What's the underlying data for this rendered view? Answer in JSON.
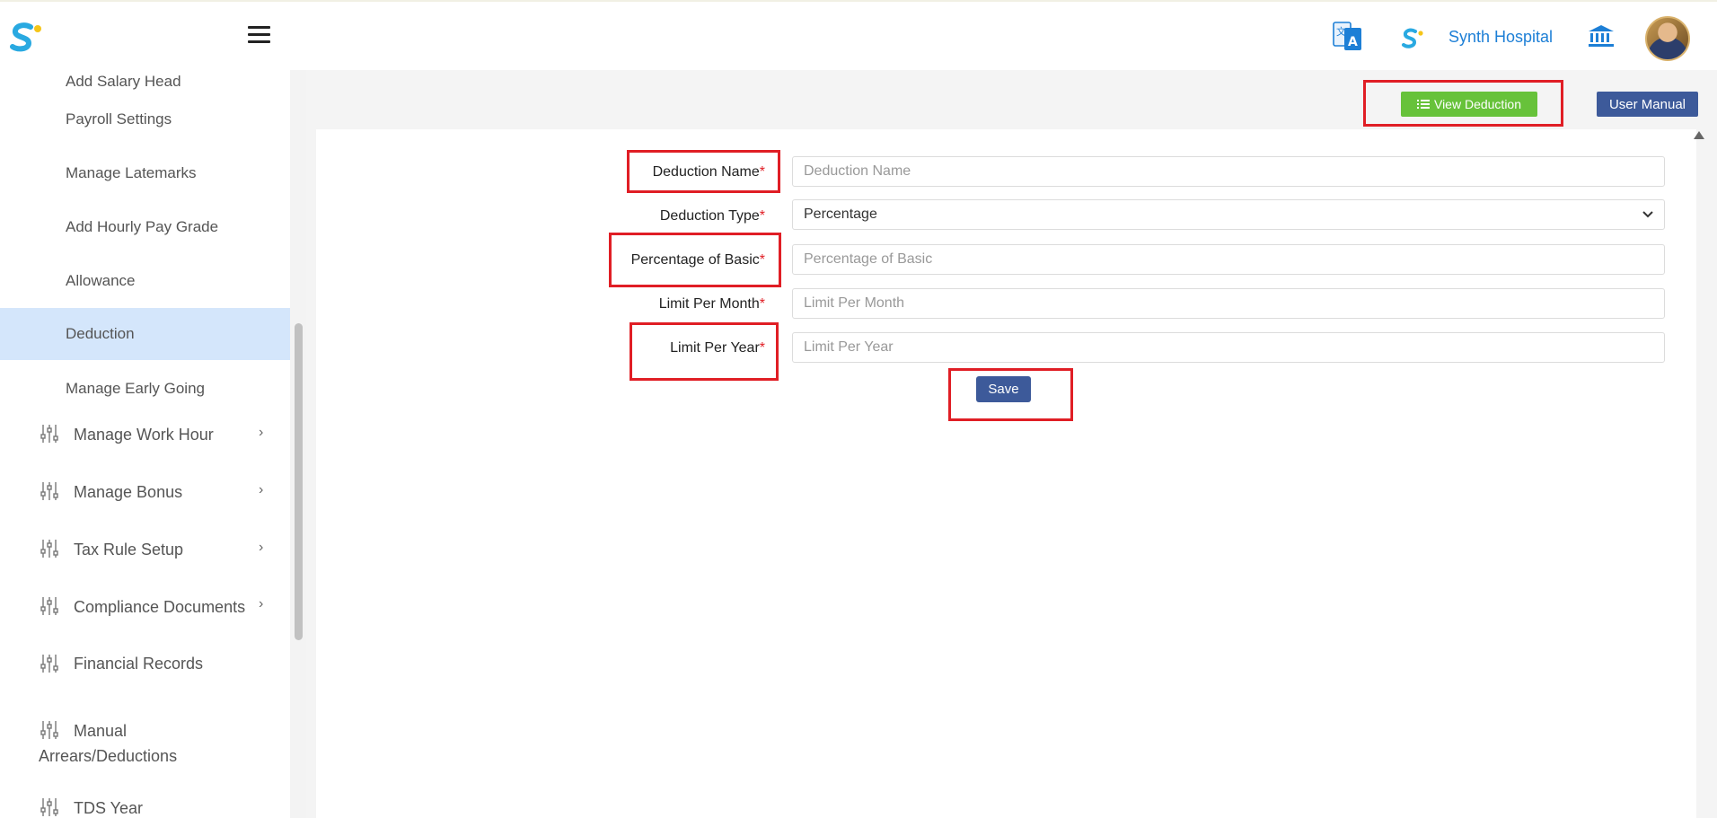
{
  "header": {
    "logo_icon": "synth-logo-icon",
    "menu_icon": "hamburger-icon",
    "translate_icon": "translate-icon",
    "hospital_logo_icon": "synth-logo-icon",
    "hospital_name": "Synth Hospital",
    "bank_icon": "bank-icon",
    "avatar": "user-avatar"
  },
  "sidebar": {
    "partial_top": "Add Salary Head",
    "items": [
      {
        "label": "Payroll Settings"
      },
      {
        "label": "Manage Latemarks"
      },
      {
        "label": "Add Hourly Pay Grade"
      },
      {
        "label": "Allowance"
      },
      {
        "label": "Deduction",
        "active": true
      },
      {
        "label": "Manage Early Going"
      }
    ],
    "groups": [
      {
        "label": "Manage Work Hour",
        "icon": "sliders-icon",
        "has_children": true
      },
      {
        "label": "Manage Bonus",
        "icon": "sliders-icon",
        "has_children": true
      },
      {
        "label": "Tax Rule Setup",
        "icon": "sliders-icon",
        "has_children": true
      },
      {
        "label": "Compliance Documents",
        "icon": "sliders-icon",
        "has_children": true
      },
      {
        "label": "Financial Records",
        "icon": "sliders-icon",
        "has_children": false
      },
      {
        "label_line1": "Manual",
        "label_line2": "Arrears/Deductions",
        "icon": "sliders-icon",
        "has_children": false
      },
      {
        "label": "TDS Year",
        "icon": "sliders-icon",
        "has_children": false
      }
    ]
  },
  "toolbar": {
    "view_deduction_label": "View Deduction",
    "view_deduction_icon": "list-icon",
    "user_manual_label": "User Manual"
  },
  "form": {
    "deduction_name": {
      "label": "Deduction Name",
      "required": "*",
      "placeholder": "Deduction Name",
      "value": ""
    },
    "deduction_type": {
      "label": "Deduction Type",
      "required": "*",
      "value": "Percentage"
    },
    "percentage_of_basic": {
      "label": "Percentage of Basic",
      "required": "*",
      "placeholder": "Percentage of Basic",
      "value": ""
    },
    "limit_per_month": {
      "label": "Limit Per Month",
      "required": "*",
      "placeholder": "Limit Per Month",
      "value": ""
    },
    "limit_per_year": {
      "label": "Limit Per Year",
      "required": "*",
      "placeholder": "Limit Per Year",
      "value": ""
    },
    "save_label": "Save"
  },
  "colors": {
    "accent_blue": "#1d7fd6",
    "primary_button": "#3d5a9a",
    "success_button": "#67c23a",
    "highlight_red": "#e01e25",
    "active_nav_bg": "#d4e6fb"
  }
}
